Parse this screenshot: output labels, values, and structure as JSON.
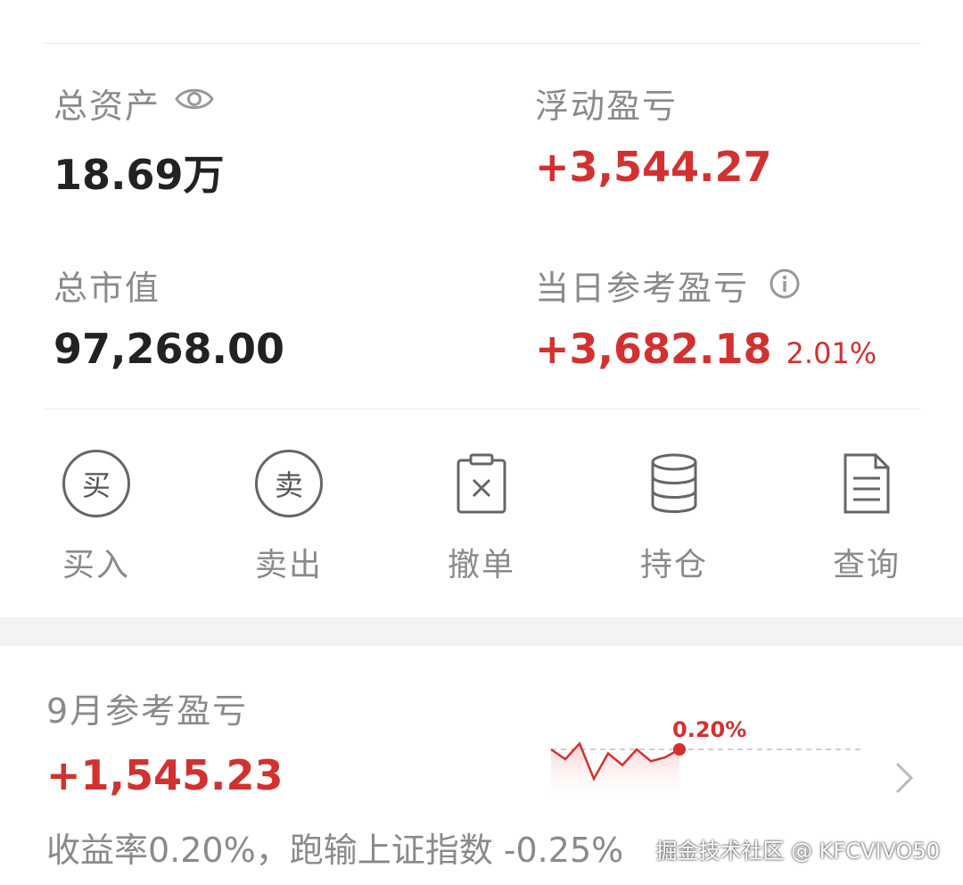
{
  "stats": {
    "total_assets_label": "总资产",
    "total_assets_value": "18.69万",
    "floating_pl_label": "浮动盈亏",
    "floating_pl_value": "+3,544.27",
    "market_value_label": "总市值",
    "market_value_value": "97,268.00",
    "daily_pl_label": "当日参考盈亏",
    "daily_pl_value": "+3,682.18",
    "daily_pl_pct": "2.01%"
  },
  "actions": [
    {
      "label": "买入",
      "glyph": "买",
      "icon": "buy-icon"
    },
    {
      "label": "卖出",
      "glyph": "卖",
      "icon": "sell-icon"
    },
    {
      "label": "撤单",
      "icon": "clipboard-x-icon"
    },
    {
      "label": "持仓",
      "icon": "database-icon"
    },
    {
      "label": "查询",
      "icon": "document-icon"
    }
  ],
  "monthly": {
    "label": "9月参考盈亏",
    "value": "+1,545.23",
    "summary": "收益率0.20%，跑输上证指数 -0.25%"
  },
  "chart_data": {
    "type": "line",
    "values": [
      0.2,
      0.15,
      0.23,
      0.05,
      0.18,
      0.12,
      0.2,
      0.14,
      0.16,
      0.2
    ],
    "annotations": [
      "0.20%"
    ],
    "reference_line": "dashed",
    "color": "#d23130"
  },
  "watermark": "掘金技术社区 @ KFCVIVO50",
  "colors": {
    "accent_red": "#d23130",
    "label_gray": "#8a8a8a",
    "separator": "#ebebeb"
  }
}
